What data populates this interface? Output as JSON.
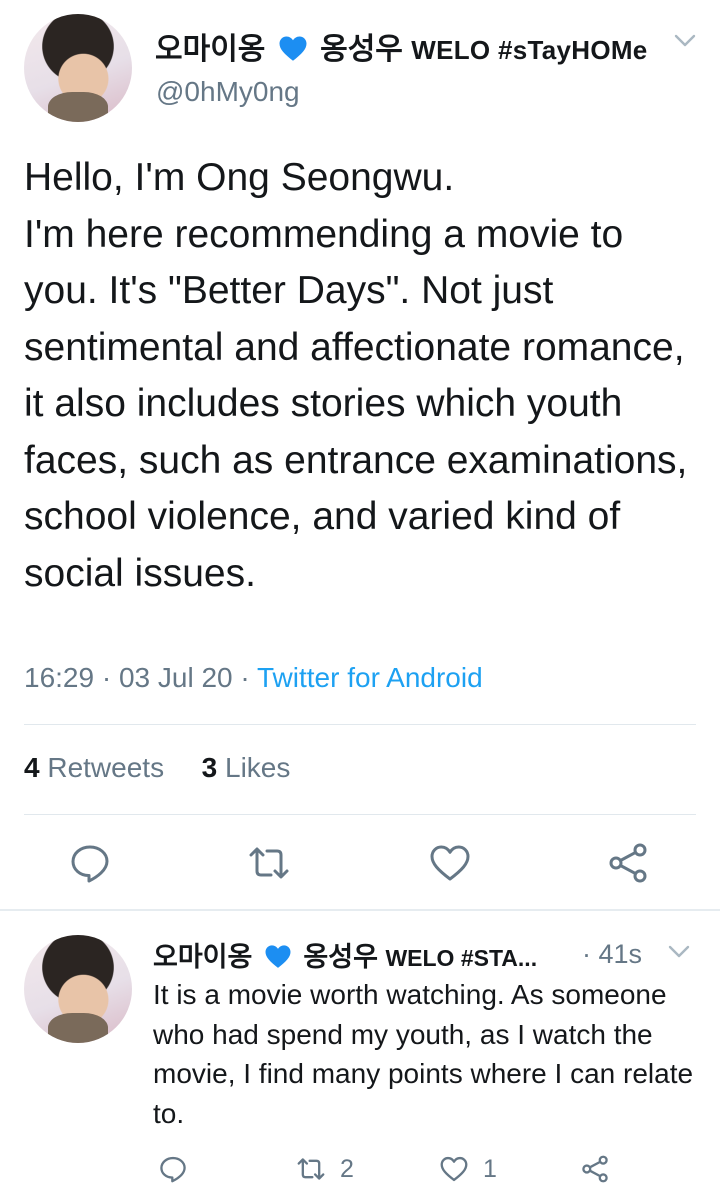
{
  "tweet": {
    "display_name": "오마이옹",
    "name_suffix": "옹성우",
    "name_tag": "WELO #sTayHOMe",
    "handle": "@0hMy0ng",
    "text": "Hello, I'm Ong Seongwu.\nI'm here recommending a movie to you. It's \"Better Days\". Not just sentimental and affectionate romance, it also includes stories which youth faces, such as entrance examinations, school violence, and varied kind of social issues.",
    "time": "16:29",
    "date": "03 Jul 20",
    "source": "Twitter for Android",
    "retweets_count": "4",
    "retweets_label": "Retweets",
    "likes_count": "3",
    "likes_label": "Likes",
    "heart_color": "#1c8ef2",
    "accent": "#1da1f2",
    "actions": [
      "reply-icon",
      "retweet-icon",
      "like-icon",
      "share-icon"
    ]
  },
  "reply": {
    "display_name": "오마이옹",
    "name_suffix": "옹성우",
    "name_tag": "WELO #STA...",
    "time": "41s",
    "text": "It is a movie worth watching. As someone who had spend my youth, as I watch the movie, I find many points where I can relate to.",
    "retweet_count": "2",
    "like_count": "1"
  }
}
